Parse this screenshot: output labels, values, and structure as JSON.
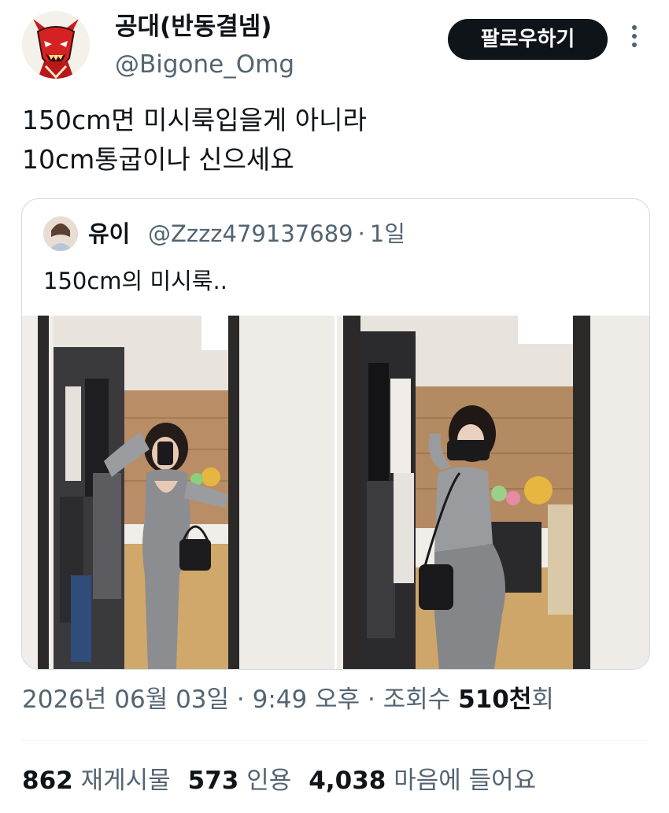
{
  "author": {
    "display_name": "공대(반동결넴)",
    "handle": "@Bigone_Omg",
    "avatar_icon": "red-demon-avatar-icon"
  },
  "follow_button_label": "팔로우하기",
  "more_icon": "more-vertical-icon",
  "tweet": {
    "lines": [
      "150cm면 미시룩입을게 아니라",
      "10cm통굽이나 신으세요"
    ]
  },
  "quote": {
    "name": "유이",
    "handle": "@Zzzz479137689",
    "separator": "·",
    "age": "1일",
    "text": "150cm의 미시룩..",
    "photos": [
      "mirror-selfie-front-photo",
      "mirror-selfie-back-photo"
    ]
  },
  "meta": {
    "date": "2026년 06월 03일",
    "separator": "·",
    "time": "9:49 오후",
    "views_label": "조회수",
    "views_count": "510천",
    "views_suffix": "회"
  },
  "stats": {
    "reposts": "862",
    "reposts_label": "재게시물",
    "quotes": "573",
    "quotes_label": "인용",
    "likes": "4,038",
    "likes_label": "마음에 들어요"
  },
  "colors": {
    "text": "#0f1419",
    "secondary_text": "#536471",
    "border": "#cfd9de",
    "button_bg": "#0f1419",
    "button_text": "#ffffff"
  }
}
